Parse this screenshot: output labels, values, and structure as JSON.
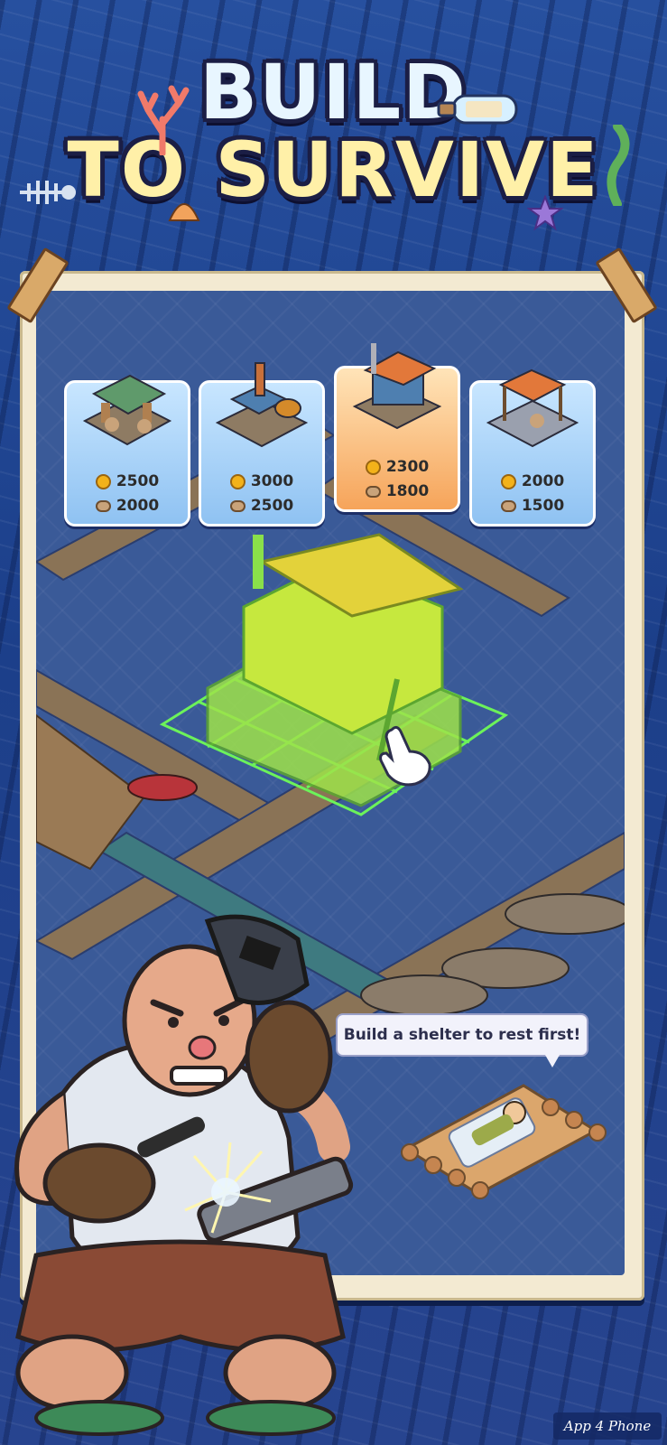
{
  "title": {
    "line1": "BUILD",
    "line2": "TO SURVIVE"
  },
  "buildings": [
    {
      "name": "market-stall",
      "coins": "2500",
      "wood": "2000",
      "selected": false
    },
    {
      "name": "workshop",
      "coins": "3000",
      "wood": "2500",
      "selected": false
    },
    {
      "name": "shelter",
      "coins": "2300",
      "wood": "1800",
      "selected": true
    },
    {
      "name": "canopy-deck",
      "coins": "2000",
      "wood": "1500",
      "selected": false
    }
  ],
  "hint_bubble": "Build a shelter to rest first!",
  "watermark": "App 4 Phone",
  "icons": [
    "coin-icon",
    "wood-log-icon",
    "pointer-hand-icon"
  ],
  "colors": {
    "card_blue": "#8fc2f2",
    "card_orange": "#f6a45a",
    "placement_green": "#6cf25a",
    "poster": "#f3ead2"
  }
}
